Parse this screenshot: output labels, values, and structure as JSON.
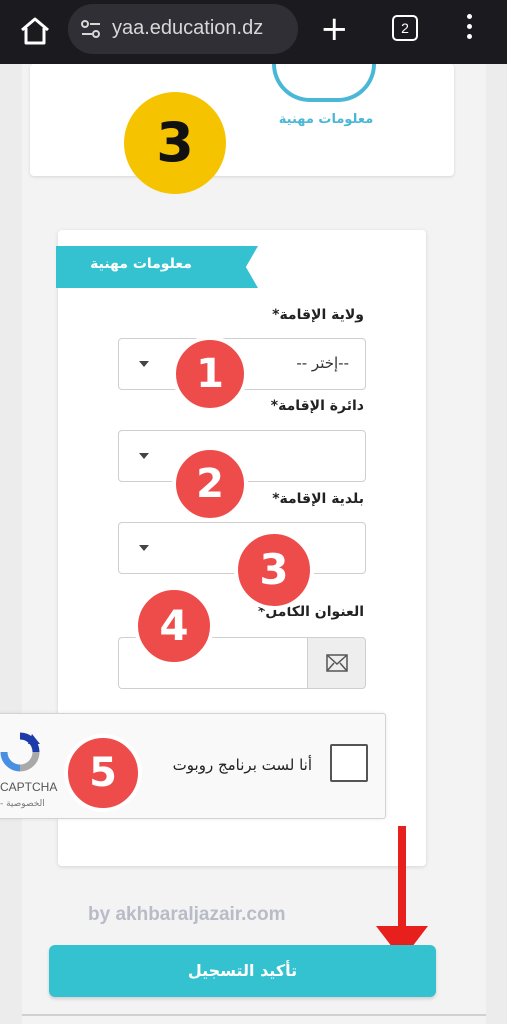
{
  "browser": {
    "url": "yaa.education.dz",
    "tab_count": "2"
  },
  "steps": {
    "current_step_label": "معلومات مهنية"
  },
  "badges": {
    "step_badge": "3",
    "wilaya_badge": "1",
    "daira_badge": "2",
    "commune_badge": "3",
    "address_badge": "4",
    "captcha_badge": "5"
  },
  "form": {
    "section_title": "معلومات مهنية",
    "wilaya_label": "ولاية الإقامة*",
    "wilaya_value": "--إختر --",
    "daira_label": "دائرة الإقامة*",
    "daira_value": "",
    "commune_label": "بلدية الإقامة*",
    "commune_value": "",
    "address_label": "العنوان الكامل*",
    "address_value": ""
  },
  "captcha": {
    "label": "أنا لست برنامج روبوت",
    "brand": "CAPTCHA",
    "privacy": "الخصوصية -"
  },
  "watermark": "by akhbaraljazair.com",
  "submit_label": "تأكيد التسجيل",
  "colors": {
    "accent": "#35c2d0",
    "badge_red": "#ee4b4b",
    "badge_yellow": "#f6c300",
    "arrow": "#e8201d"
  }
}
